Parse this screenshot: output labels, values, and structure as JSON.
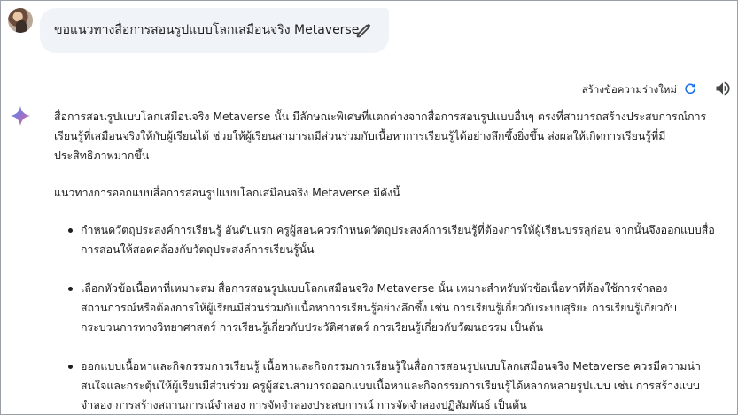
{
  "prompt": {
    "text": "ขอแนวทางสื่อการสอนรูปแบบโลกเสมือนจริง Metaverse"
  },
  "response_header": {
    "regenerate_label": "สร้างข้อความร่างใหม่"
  },
  "response": {
    "intro": "สื่อการสอนรูปแบบโลกเสมือนจริง Metaverse นั้น มีลักษณะพิเศษที่แตกต่างจากสื่อการสอนรูปแบบอื่นๆ ตรงที่สามารถสร้างประสบการณ์การเรียนรู้ที่เสมือนจริงให้กับผู้เรียนได้ ช่วยให้ผู้เรียนสามารถมีส่วนร่วมกับเนื้อหาการเรียนรู้ได้อย่างลึกซึ้งยิ่งขึ้น ส่งผลให้เกิดการเรียนรู้ที่มีประสิทธิภาพมากขึ้น",
    "guideline_heading": "แนวทางการออกแบบสื่อการสอนรูปแบบโลกเสมือนจริง Metaverse มีดังนี้",
    "bullets": [
      "กำหนดวัตถุประสงค์การเรียนรู้ อันดับแรก ครูผู้สอนควรกำหนดวัตถุประสงค์การเรียนรู้ที่ต้องการให้ผู้เรียนบรรลุก่อน จากนั้นจึงออกแบบสื่อการสอนให้สอดคล้องกับวัตถุประสงค์การเรียนรู้นั้น",
      "เลือกหัวข้อเนื้อหาที่เหมาะสม สื่อการสอนรูปแบบโลกเสมือนจริง Metaverse นั้น เหมาะสำหรับหัวข้อเนื้อหาที่ต้องใช้การจำลองสถานการณ์หรือต้องการให้ผู้เรียนมีส่วนร่วมกับเนื้อหาการเรียนรู้อย่างลึกซึ้ง เช่น การเรียนรู้เกี่ยวกับระบบสุริยะ การเรียนรู้เกี่ยวกับกระบวนการทางวิทยาศาสตร์ การเรียนรู้เกี่ยวกับประวัติศาสตร์ การเรียนรู้เกี่ยวกับวัฒนธรรม เป็นต้น",
      "ออกแบบเนื้อหาและกิจกรรมการเรียนรู้ เนื้อหาและกิจกรรมการเรียนรู้ในสื่อการสอนรูปแบบโลกเสมือนจริง Metaverse ควรมีความน่าสนใจและกระตุ้นให้ผู้เรียนมีส่วนร่วม ครูผู้สอนสามารถออกแบบเนื้อหาและกิจกรรมการเรียนรู้ได้หลากหลายรูปแบบ เช่น การสร้างแบบจำลอง การสร้างสถานการณ์จำลอง การจัดจำลองประสบการณ์ การจัดจำลองปฏิสัมพันธ์ เป็นต้น"
    ]
  },
  "icons": {
    "avatar": "user-avatar",
    "edit": "pencil-icon",
    "refresh": "refresh-icon",
    "speaker": "speaker-icon",
    "sparkle": "gemini-sparkle-icon"
  },
  "colors": {
    "bubble_bg": "#f0f4f9",
    "accent_blue": "#1a73e8",
    "text": "#1f1f1f"
  }
}
